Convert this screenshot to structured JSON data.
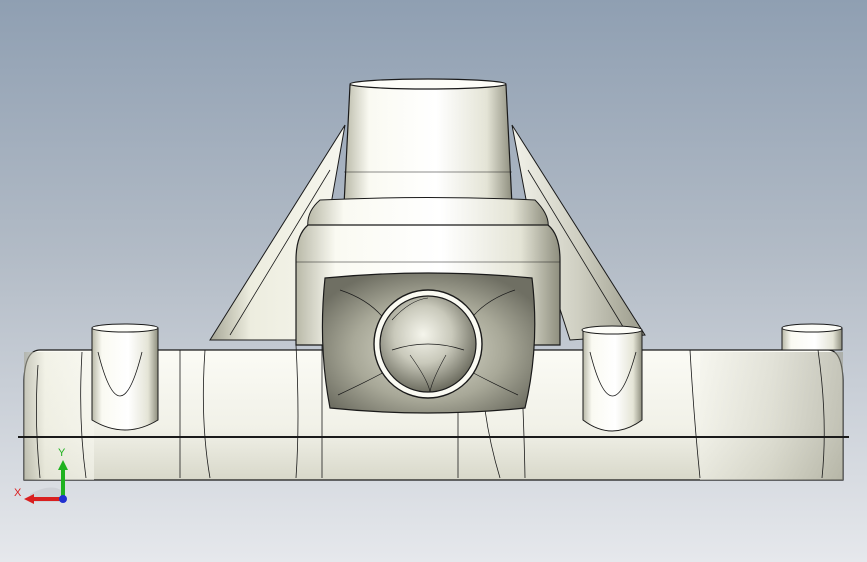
{
  "viewport": {
    "background_top": "#8f9fb2",
    "background_bottom": "#e6e8ec",
    "model_fill": "#f4f4ee",
    "model_shade": "#9a9a8a",
    "edge_color": "#1a1a1a"
  },
  "triad": {
    "x_label": "X",
    "y_label": "Y",
    "x_color": "#d91f1f",
    "y_color": "#1fb21f",
    "z_color": "#2030d0"
  }
}
